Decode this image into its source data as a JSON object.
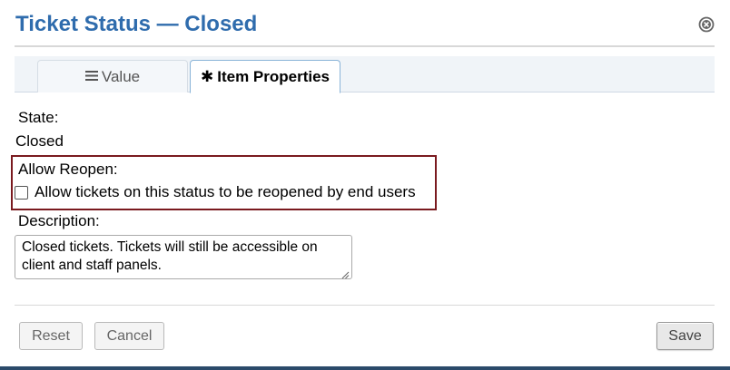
{
  "dialog": {
    "title": "Ticket Status — Closed",
    "close_icon": "close-circle-icon"
  },
  "tabs": [
    {
      "label": "Value",
      "icon": "list-icon",
      "active": false
    },
    {
      "label": "Item Properties",
      "icon": "asterisk-icon",
      "active": true
    }
  ],
  "form": {
    "state_label": "State:",
    "state_value": "Closed",
    "allow_reopen_label": "Allow Reopen:",
    "allow_reopen_checkbox_label": "Allow tickets on this status to be reopened by end users",
    "allow_reopen_checked": false,
    "description_label": "Description:",
    "description_value": "Closed tickets. Tickets will still be accessible on client and staff panels."
  },
  "buttons": {
    "reset": "Reset",
    "cancel": "Cancel",
    "save": "Save"
  },
  "colors": {
    "title": "#2f6cad",
    "highlight_border": "#7a1a1f",
    "bottom_strip": "#2b4a6a"
  }
}
